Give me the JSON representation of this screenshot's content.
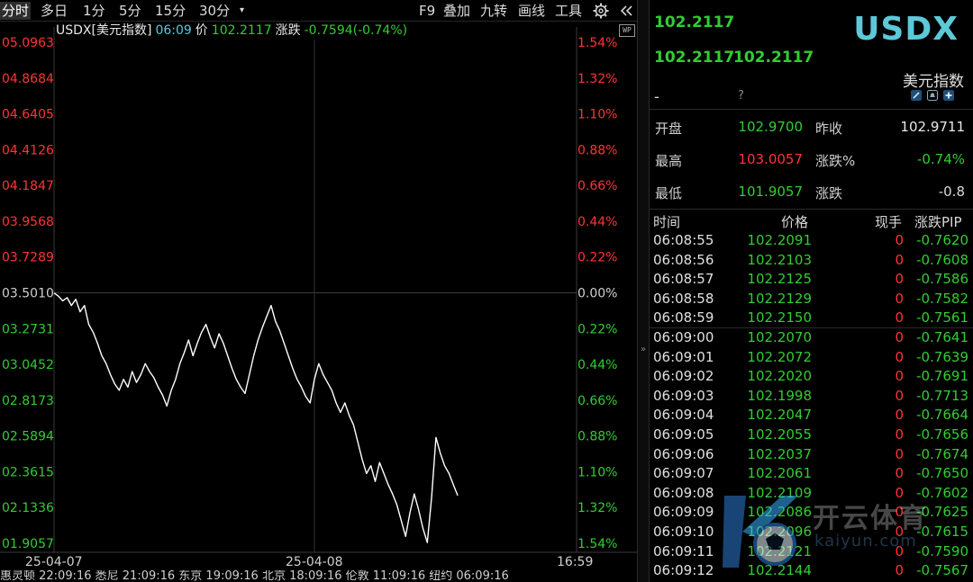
{
  "toolbar": {
    "left": [
      "分时",
      "多日",
      "1分",
      "5分",
      "15分",
      "30分"
    ],
    "more_arrow": "▾",
    "right": [
      "F9",
      "叠加",
      "九转",
      "画线",
      "工具"
    ]
  },
  "info_line": {
    "symbol": "USDX[美元指数]",
    "time": "06:09",
    "price_label": "价",
    "price": "102.2117",
    "change_label": "涨跌",
    "change": "-0.7594(-0.74%)"
  },
  "chart_data": {
    "type": "line",
    "title": "",
    "prev_close": 103.501,
    "y_labels_left": [
      "05.0963",
      "04.8684",
      "04.6405",
      "04.4126",
      "04.1847",
      "03.9568",
      "03.7289",
      "03.5010",
      "03.2731",
      "03.0452",
      "02.8173",
      "02.5894",
      "02.3615",
      "02.1336",
      "01.9057"
    ],
    "y_labels_right": [
      "1.54%",
      "1.32%",
      "1.10%",
      "0.88%",
      "0.66%",
      "0.44%",
      "0.22%",
      "0.00%",
      "0.22%",
      "0.44%",
      "0.66%",
      "0.88%",
      "1.10%",
      "1.32%",
      "1.54%"
    ],
    "x_labels": [
      "25-04-07",
      "25-04-08",
      "16:59"
    ],
    "ylim": [
      101.9057,
      105.0963
    ],
    "series": [
      {
        "values": [
          103.5,
          103.48,
          103.45,
          103.47,
          103.42,
          103.46,
          103.38,
          103.42,
          103.3,
          103.25,
          103.18,
          103.1,
          103.05,
          102.98,
          102.92,
          102.88,
          102.95,
          102.9,
          103.0,
          102.93,
          102.98,
          103.05,
          103.0,
          102.96,
          102.9,
          102.85,
          102.78,
          102.88,
          102.95,
          103.05,
          103.12,
          103.2,
          103.1,
          103.18,
          103.25,
          103.3,
          103.22,
          103.15,
          103.24,
          103.18,
          103.1,
          103.02,
          102.95,
          102.9,
          102.86,
          102.98,
          103.1,
          103.2,
          103.28,
          103.35,
          103.42,
          103.32,
          103.26,
          103.18,
          103.1,
          103.02,
          102.95,
          102.9,
          102.84,
          102.8,
          102.95,
          103.05,
          102.98,
          102.93,
          102.88,
          102.8,
          102.74,
          102.8,
          102.72,
          102.66,
          102.55,
          102.44,
          102.35,
          102.4,
          102.3,
          102.42,
          102.35,
          102.28,
          102.22,
          102.15,
          102.05,
          101.95,
          102.1,
          102.22,
          102.12,
          102.0,
          101.91,
          102.2,
          102.58,
          102.48,
          102.4,
          102.35,
          102.28,
          102.21
        ]
      }
    ]
  },
  "bottom_bar": "惠灵顿 22:09:16   悉尼 21:09:16   东京 19:09:16   北京 18:09:16   伦敦 11:09:16   纽约 06:09:16",
  "quote": {
    "code": "USDX",
    "name": "美元指数",
    "price": "102.2117",
    "bid": "102.2117",
    "ask": "102.2117",
    "dash": "-",
    "question": "?",
    "stats": [
      {
        "label": "开盘",
        "value": "102.9700",
        "color": "#33cc33"
      },
      {
        "label": "昨收",
        "value": "102.9711",
        "color": "#e8e8e8"
      },
      {
        "label": "最高",
        "value": "103.0057",
        "color": "#ff3333"
      },
      {
        "label": "涨跌%",
        "value": "-0.74%",
        "color": "#33cc33"
      },
      {
        "label": "最低",
        "value": "101.9057",
        "color": "#33cc33"
      },
      {
        "label": "涨跌",
        "value": "-0.8",
        "color": "#33cc33"
      }
    ]
  },
  "ticks": {
    "headers": {
      "time": "时间",
      "price": "价格",
      "vol": "现手",
      "pip": "涨跌PIP"
    },
    "rows": [
      {
        "time": "06:08:55",
        "price": "102.2091",
        "vol": "0",
        "pip": "-0.7620"
      },
      {
        "time": "06:08:56",
        "price": "102.2103",
        "vol": "0",
        "pip": "-0.7608"
      },
      {
        "time": "06:08:57",
        "price": "102.2125",
        "vol": "0",
        "pip": "-0.7586"
      },
      {
        "time": "06:08:58",
        "price": "102.2129",
        "vol": "0",
        "pip": "-0.7582"
      },
      {
        "time": "06:08:59",
        "price": "102.2150",
        "vol": "0",
        "pip": "-0.7561"
      },
      {
        "time": "06:09:00",
        "price": "102.2070",
        "vol": "0",
        "pip": "-0.7641"
      },
      {
        "time": "06:09:01",
        "price": "102.2072",
        "vol": "0",
        "pip": "-0.7639"
      },
      {
        "time": "06:09:02",
        "price": "102.2020",
        "vol": "0",
        "pip": "-0.7691"
      },
      {
        "time": "06:09:03",
        "price": "102.1998",
        "vol": "0",
        "pip": "-0.7713"
      },
      {
        "time": "06:09:04",
        "price": "102.2047",
        "vol": "0",
        "pip": "-0.7664"
      },
      {
        "time": "06:09:05",
        "price": "102.2055",
        "vol": "0",
        "pip": "-0.7656"
      },
      {
        "time": "06:09:06",
        "price": "102.2037",
        "vol": "0",
        "pip": "-0.7674"
      },
      {
        "time": "06:09:07",
        "price": "102.2061",
        "vol": "0",
        "pip": "-0.7650"
      },
      {
        "time": "06:09:08",
        "price": "102.2109",
        "vol": "0",
        "pip": "-0.7602"
      },
      {
        "time": "06:09:09",
        "price": "102.2086",
        "vol": "0",
        "pip": "-0.7625"
      },
      {
        "time": "06:09:10",
        "price": "102.2096",
        "vol": "0",
        "pip": "-0.7615"
      },
      {
        "time": "06:09:11",
        "price": "102.2121",
        "vol": "0",
        "pip": "-0.7590"
      },
      {
        "time": "06:09:12",
        "price": "102.2144",
        "vol": "0",
        "pip": "-0.7567"
      }
    ]
  },
  "watermark": {
    "text": "开云体育",
    "sub": "kaiyun.com"
  },
  "colors": {
    "up": "#ff3333",
    "down": "#33cc33",
    "code": "#5cc8d8",
    "line": "#ffffff",
    "time": "#5cc8d8"
  }
}
